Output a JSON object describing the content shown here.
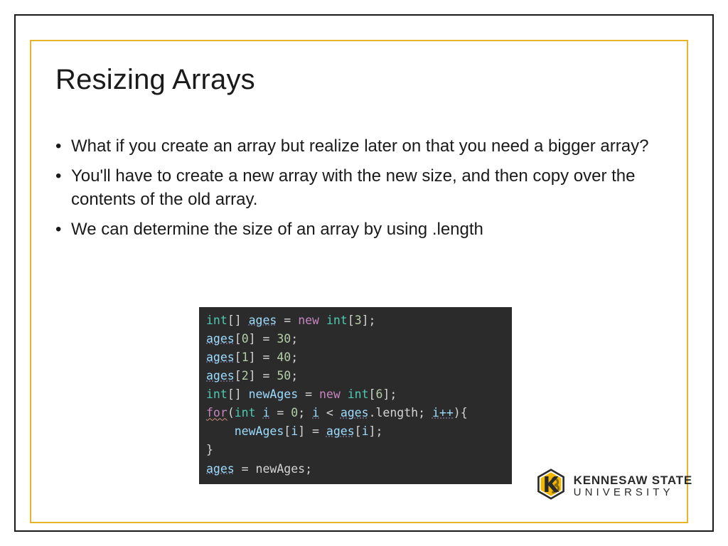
{
  "title": "Resizing Arrays",
  "bullets": [
    "What if you create an array but realize later on that you need a bigger array?",
    "You'll have to create a new array with the new size, and then copy over the contents of the old array.",
    "We can determine the size of an array by using .length"
  ],
  "code": {
    "lines": [
      [
        {
          "t": "int",
          "c": "tk-type"
        },
        {
          "t": "[] ",
          "c": "tk-punct"
        },
        {
          "t": "ages",
          "c": "tk-var"
        },
        {
          "t": " = ",
          "c": "tk-punct"
        },
        {
          "t": "new",
          "c": "tk-kw"
        },
        {
          "t": " ",
          "c": "tk-punct"
        },
        {
          "t": "int",
          "c": "tk-type"
        },
        {
          "t": "[",
          "c": "tk-punct"
        },
        {
          "t": "3",
          "c": "tk-num"
        },
        {
          "t": "];",
          "c": "tk-punct"
        }
      ],
      [
        {
          "t": "ages",
          "c": "tk-var"
        },
        {
          "t": "[",
          "c": "tk-punct"
        },
        {
          "t": "0",
          "c": "tk-num"
        },
        {
          "t": "] = ",
          "c": "tk-punct"
        },
        {
          "t": "30",
          "c": "tk-num"
        },
        {
          "t": ";",
          "c": "tk-punct"
        }
      ],
      [
        {
          "t": "ages",
          "c": "tk-var"
        },
        {
          "t": "[",
          "c": "tk-punct"
        },
        {
          "t": "1",
          "c": "tk-num"
        },
        {
          "t": "] = ",
          "c": "tk-punct"
        },
        {
          "t": "40",
          "c": "tk-num"
        },
        {
          "t": ";",
          "c": "tk-punct"
        }
      ],
      [
        {
          "t": "ages",
          "c": "tk-var"
        },
        {
          "t": "[",
          "c": "tk-punct"
        },
        {
          "t": "2",
          "c": "tk-num"
        },
        {
          "t": "] = ",
          "c": "tk-punct"
        },
        {
          "t": "50",
          "c": "tk-num"
        },
        {
          "t": ";",
          "c": "tk-punct"
        }
      ],
      [
        {
          "t": "int",
          "c": "tk-type"
        },
        {
          "t": "[] ",
          "c": "tk-punct"
        },
        {
          "t": "newAges",
          "c": "tk-plain"
        },
        {
          "t": " = ",
          "c": "tk-punct"
        },
        {
          "t": "new",
          "c": "tk-kw"
        },
        {
          "t": " ",
          "c": "tk-punct"
        },
        {
          "t": "int",
          "c": "tk-type"
        },
        {
          "t": "[",
          "c": "tk-punct"
        },
        {
          "t": "6",
          "c": "tk-num"
        },
        {
          "t": "];",
          "c": "tk-punct"
        }
      ],
      [
        {
          "t": "for",
          "c": "tk-for"
        },
        {
          "t": "(",
          "c": "tk-punct"
        },
        {
          "t": "int",
          "c": "tk-type"
        },
        {
          "t": " ",
          "c": "tk-punct"
        },
        {
          "t": "i",
          "c": "tk-var"
        },
        {
          "t": " = ",
          "c": "tk-punct"
        },
        {
          "t": "0",
          "c": "tk-num"
        },
        {
          "t": "; ",
          "c": "tk-punct"
        },
        {
          "t": "i",
          "c": "tk-var"
        },
        {
          "t": " < ",
          "c": "tk-punct"
        },
        {
          "t": "ages",
          "c": "tk-var"
        },
        {
          "t": ".length; ",
          "c": "tk-prop"
        },
        {
          "t": "i++",
          "c": "tk-var"
        },
        {
          "t": "){",
          "c": "tk-punct"
        }
      ],
      [
        {
          "t": "    newAges",
          "c": "tk-plain"
        },
        {
          "t": "[",
          "c": "tk-punct"
        },
        {
          "t": "i",
          "c": "tk-plain"
        },
        {
          "t": "] = ",
          "c": "tk-punct"
        },
        {
          "t": "ages",
          "c": "tk-var"
        },
        {
          "t": "[",
          "c": "tk-punct"
        },
        {
          "t": "i",
          "c": "tk-plain"
        },
        {
          "t": "];",
          "c": "tk-punct"
        }
      ],
      [
        {
          "t": "}",
          "c": "tk-punct"
        }
      ],
      [
        {
          "t": "ages",
          "c": "tk-var"
        },
        {
          "t": " = newAges;",
          "c": "tk-punct"
        }
      ]
    ]
  },
  "logo": {
    "line1": "KENNESAW STATE",
    "line2": "UNIVERSITY"
  }
}
